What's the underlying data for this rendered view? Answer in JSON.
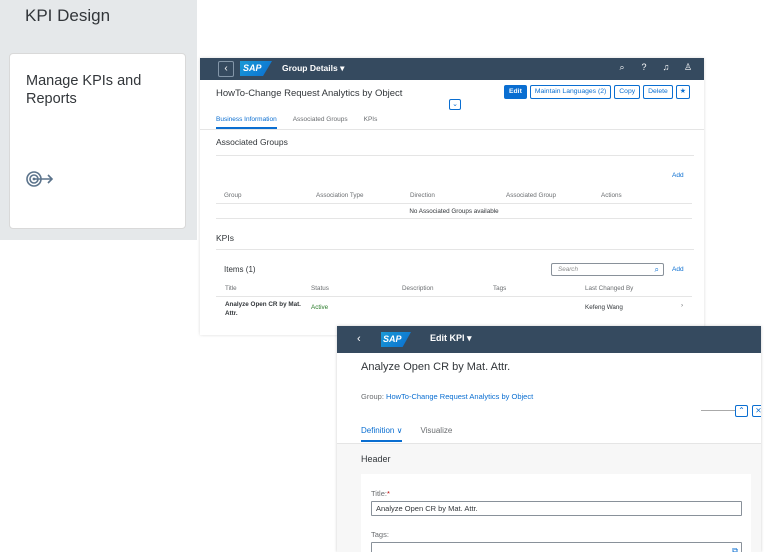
{
  "launchpad": {
    "group_title": "KPI Design",
    "tile_title": "Manage KPIs and Reports",
    "tile_icon": "kpi-target-icon"
  },
  "group_window": {
    "shell_title": "Group Details ▾",
    "object_title": "HowTo-Change Request Analytics by Object",
    "actions": {
      "edit": "Edit",
      "maintain_languages": "Maintain Languages (2)",
      "copy": "Copy",
      "delete": "Delete",
      "favorite": "★"
    },
    "tabs": [
      "Business Information",
      "Associated Groups",
      "KPIs"
    ],
    "associated_groups": {
      "title": "Associated Groups",
      "add": "Add",
      "columns": [
        "Group",
        "Association Type",
        "Direction",
        "Associated Group",
        "Actions"
      ],
      "empty_text": "No Associated Groups available"
    },
    "kpis": {
      "title": "KPIs",
      "items_label": "Items (1)",
      "search_placeholder": "Search",
      "add": "Add",
      "columns": [
        "Title",
        "Status",
        "Description",
        "Tags",
        "Last Changed By"
      ],
      "rows": [
        {
          "title": "Analyze Open CR by Mat. Attr.",
          "status": "Active",
          "description": "",
          "tags": "",
          "last_changed_by": "Kefeng Wang"
        }
      ]
    }
  },
  "edit_window": {
    "shell_title": "Edit KPI ▾",
    "title": "Analyze Open CR by Mat. Attr.",
    "group_label": "Group:",
    "group_link": "HowTo-Change Request Analytics by Object",
    "tabs": [
      "Definition ∨",
      "Visualize"
    ],
    "section": "Header",
    "title_label": "Title:",
    "title_required": "*",
    "title_value": "Analyze Open CR by Mat. Attr.",
    "tags_label": "Tags:"
  },
  "colors": {
    "shell": "#354a5f",
    "accent": "#0a6ed1",
    "positive": "#2b7c2b"
  }
}
